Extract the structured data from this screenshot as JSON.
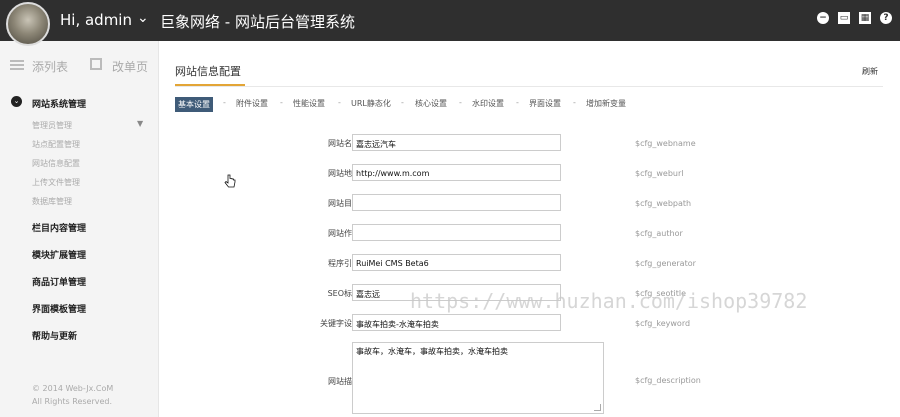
{
  "header": {
    "greeting": "Hi, admin",
    "system_title": "巨象网络 - 网站后台管理系统",
    "icons": [
      "minus-circle-icon",
      "monitor-icon",
      "grid-icon",
      "help-icon"
    ]
  },
  "sidebar": {
    "list_label": "添列表",
    "edit_label": "改单页",
    "groups": [
      {
        "label": "网站系统管理",
        "items": [
          "管理员管理",
          "站点配置管理",
          "网站信息配置",
          "上传文件管理",
          "数据库管理"
        ]
      },
      {
        "label": "栏目内容管理"
      },
      {
        "label": "模块扩展管理"
      },
      {
        "label": "商品订单管理"
      },
      {
        "label": "界面模板管理"
      },
      {
        "label": "帮助与更新"
      }
    ],
    "copyright_line1": "© 2014 Web-Jx.CoM",
    "copyright_line2": "All Rights Reserved."
  },
  "main": {
    "title": "网站信息配置",
    "refresh": "刷新",
    "tabs": [
      "基本设置",
      "附件设置",
      "性能设置",
      "URL静态化",
      "核心设置",
      "水印设置",
      "界面设置",
      "增加新变量"
    ],
    "fields": [
      {
        "label": "网站名称：",
        "value": "嘉志远汽车",
        "var": "$cfg_webname"
      },
      {
        "label": "网站地址：",
        "value": "http://www.m.com",
        "var": "$cfg_weburl"
      },
      {
        "label": "网站目录：",
        "value": "",
        "var": "$cfg_webpath"
      },
      {
        "label": "网站作者：",
        "value": "",
        "var": "$cfg_author"
      },
      {
        "label": "程序引擎：",
        "value": "RuiMei CMS Beta6",
        "var": "$cfg_generator"
      },
      {
        "label": "SEO标题：",
        "value": "嘉志远",
        "var": "$cfg_seotitle"
      },
      {
        "label": "关键字设置：",
        "value": "事故车拍卖-水淹车拍卖",
        "var": "$cfg_keyword"
      },
      {
        "label": "网站描述：",
        "value": "事故车，水淹车，事故车拍卖，水淹车拍卖",
        "var": "$cfg_description"
      }
    ]
  },
  "watermark": "https://www.huzhan.com/ishop39782"
}
